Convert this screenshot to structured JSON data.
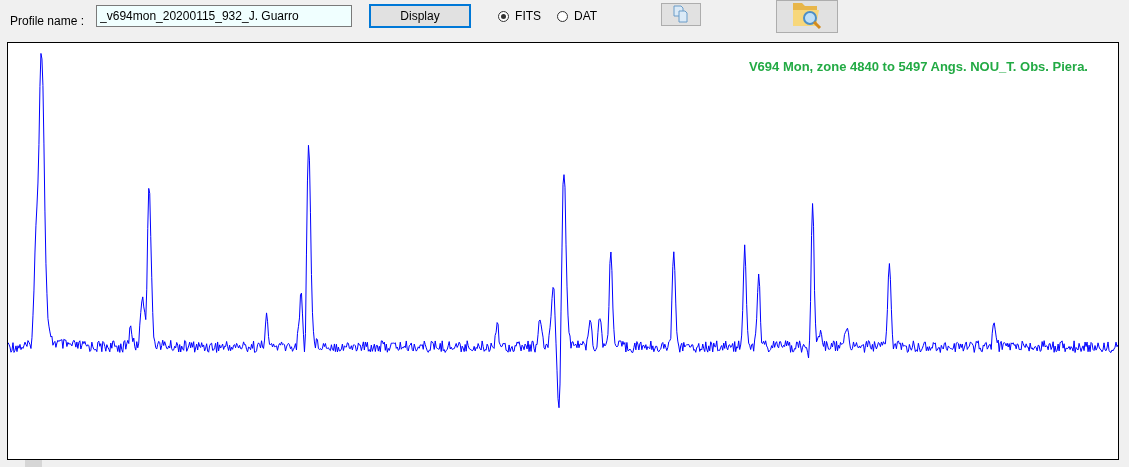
{
  "profile": {
    "label": "Profile name :",
    "value": "_v694mon_20200115_932_J. Guarro"
  },
  "display_button": "Display",
  "formats": [
    {
      "label": "FITS",
      "selected": true
    },
    {
      "label": "DAT",
      "selected": false
    }
  ],
  "plot": {
    "caption": "V694 Mon, zone 4840 to 5497 Angs. NOU_T. Obs. Piera."
  }
}
